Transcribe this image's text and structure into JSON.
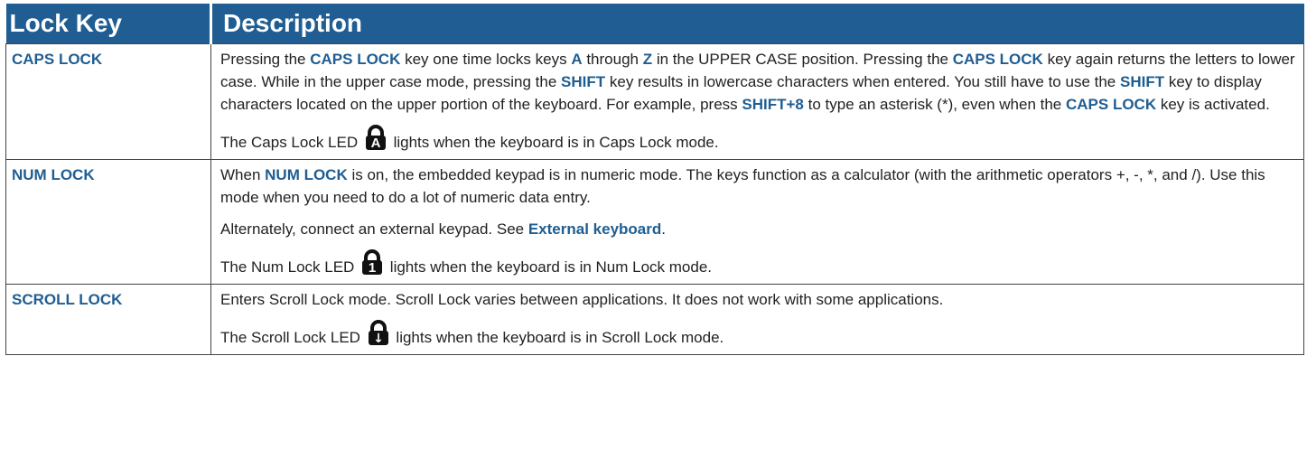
{
  "header": {
    "col1": "Lock Key",
    "col2": "Description"
  },
  "colors": {
    "header_bg": "#1f5d92",
    "keyword": "#1f5d92",
    "text": "#222222"
  },
  "rows": [
    {
      "key": "CAPS LOCK",
      "p1": {
        "t0": "Pressing the ",
        "b0": "CAPS LOCK",
        "t1": " key one time locks keys ",
        "b1": "A",
        "t2": " through ",
        "b2": "Z",
        "t3": " in the UPPER CASE position. Pressing the ",
        "b3": "CAPS LOCK",
        "t4": " key again returns the letters to lower case. While in the upper case mode, pressing the ",
        "b4": "SHIFT",
        "t5": " key results in lowercase characters when entered. You still have to use the ",
        "b5": "SHIFT",
        "t6": " key to display characters located on the upper portion of the keyboard. For example, press ",
        "b6": "SHIFT+8",
        "t7": " to type an asterisk (*), even when the ",
        "b7": "CAPS LOCK",
        "t8": " key is activated."
      },
      "p2": {
        "before": "The Caps Lock LED ",
        "icon": "caps-lock-led-icon",
        "icon_glyph": "A",
        "after": " lights when the keyboard is in Caps Lock mode."
      }
    },
    {
      "key": "NUM LOCK",
      "p1": {
        "t0": "When ",
        "b0": "NUM LOCK",
        "t1": " is on, the embedded keypad is in numeric mode. The keys function as a calculator (with the arithmetic operators +, -, *, and /). Use this mode when you need to do a lot of numeric data entry."
      },
      "p2": {
        "before": "Alternately, connect an external keypad. See ",
        "link": "External keyboard",
        "after": "."
      },
      "p3": {
        "before": "The Num Lock LED ",
        "icon": "num-lock-led-icon",
        "icon_glyph": "1",
        "after": " lights when the keyboard is in Num Lock mode."
      }
    },
    {
      "key": "SCROLL LOCK",
      "p1": {
        "text": "Enters Scroll Lock mode. Scroll Lock varies between applications. It does not work with some applications."
      },
      "p2": {
        "before": "The Scroll Lock LED ",
        "icon": "scroll-lock-led-icon",
        "icon_glyph": "↓",
        "after": " lights when the keyboard is in Scroll Lock mode."
      }
    }
  ]
}
